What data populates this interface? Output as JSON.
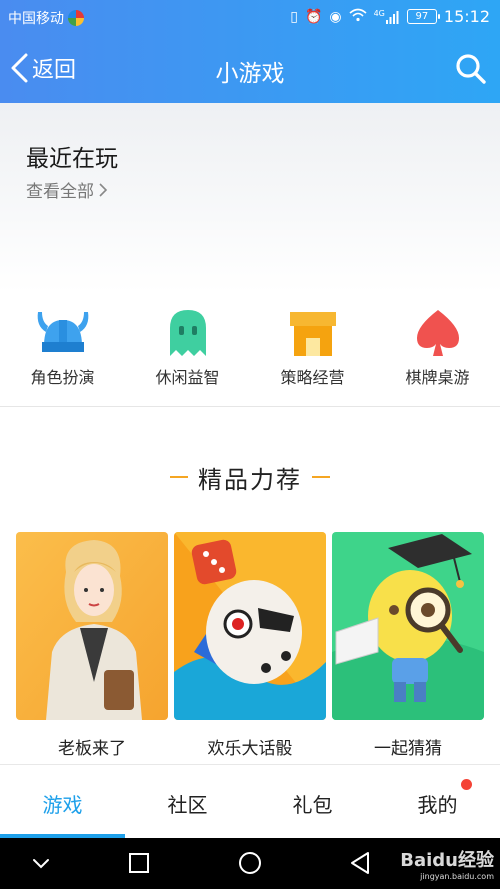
{
  "status_bar": {
    "carrier": "中国移动",
    "network_tag": "4G",
    "battery": "97",
    "time": "15:12"
  },
  "header": {
    "back_label": "返回",
    "title": "小游戏"
  },
  "recent": {
    "title": "最近在玩",
    "view_all": "查看全部"
  },
  "categories": [
    {
      "label": "角色扮演",
      "icon": "viking-helmet-icon",
      "color": "#3ea2ee"
    },
    {
      "label": "休闲益智",
      "icon": "ghost-icon",
      "color": "#3fcfa0"
    },
    {
      "label": "策略经营",
      "icon": "shop-icon",
      "color": "#f7b731"
    },
    {
      "label": "棋牌桌游",
      "icon": "spade-icon",
      "color": "#f0524f"
    }
  ],
  "featured": {
    "title": "精品力荐",
    "games": [
      {
        "name": "老板来了"
      },
      {
        "name": "欢乐大话骰"
      },
      {
        "name": "一起猜猜"
      }
    ]
  },
  "tabs": [
    {
      "label": "游戏",
      "active": true
    },
    {
      "label": "社区",
      "active": false
    },
    {
      "label": "礼包",
      "active": false
    },
    {
      "label": "我的",
      "active": false,
      "badge": true
    }
  ],
  "watermark": {
    "text": "Baidu经验",
    "sub": "jingyan.baidu.com"
  },
  "colors": {
    "header_start": "#4a8cf0",
    "header_end": "#2ea6f5",
    "accent": "#1ea0ea",
    "featured_dash": "#f5a623",
    "badge": "#f44336"
  }
}
